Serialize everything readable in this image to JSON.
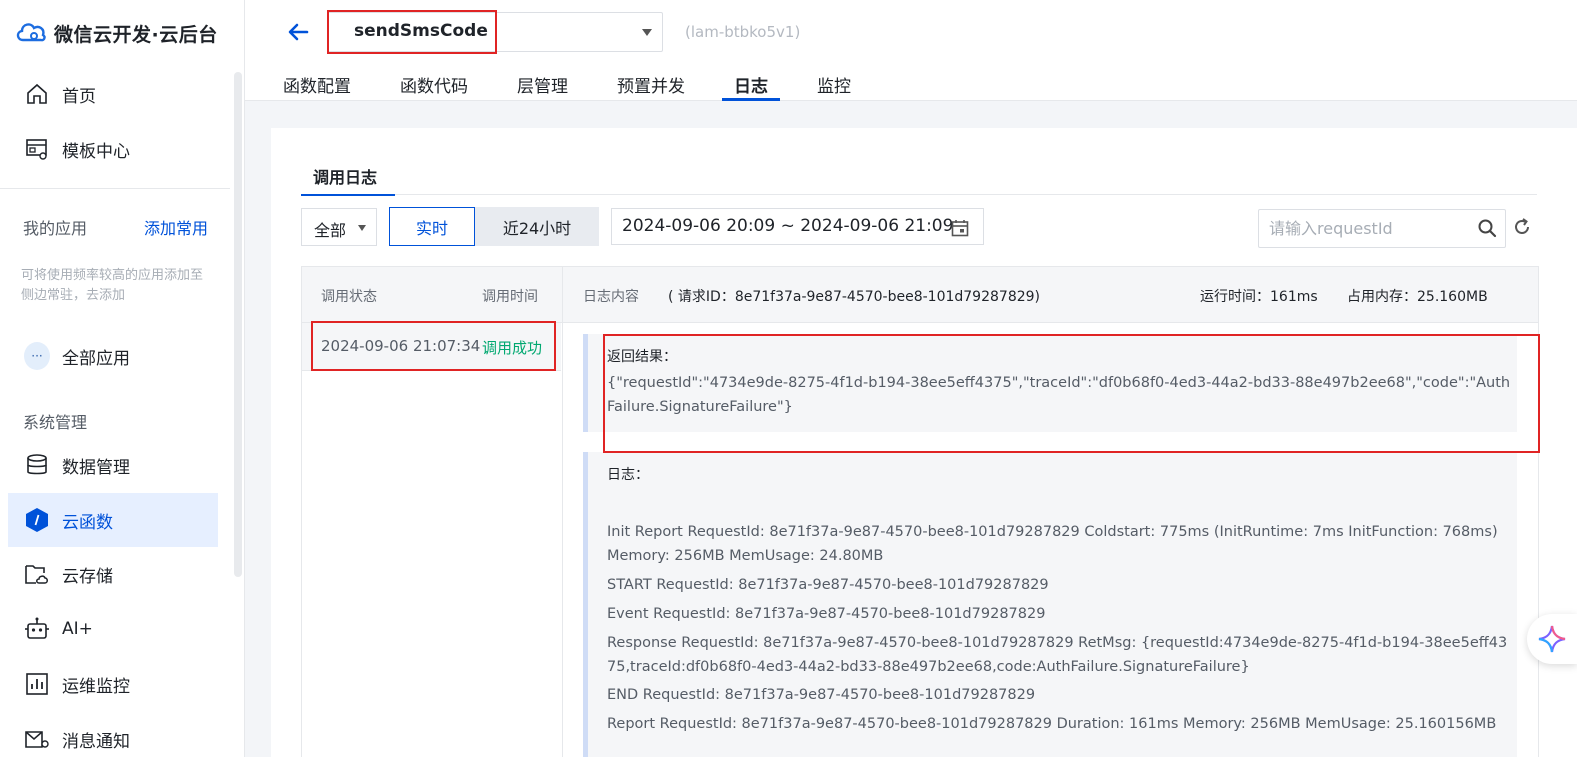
{
  "brand": {
    "title": "微信云开发·云后台"
  },
  "sidebar": {
    "top_items": [
      {
        "label": "首页",
        "icon": "home-icon"
      },
      {
        "label": "模板中心",
        "icon": "template-icon"
      }
    ],
    "my_apps_label": "我的应用",
    "add_common_label": "添加常用",
    "hint": "可将使用频率较高的应用添加至侧边常驻，去添加",
    "all_apps_label": "全部应用",
    "system_label": "系统管理",
    "system_items": [
      {
        "label": "数据管理",
        "icon": "database-icon"
      },
      {
        "label": "云函数",
        "icon": "cloud-function-icon",
        "active": true
      },
      {
        "label": "云存储",
        "icon": "cloud-storage-icon"
      },
      {
        "label": "AI+",
        "icon": "robot-icon"
      },
      {
        "label": "运维监控",
        "icon": "monitor-chart-icon"
      },
      {
        "label": "消息通知",
        "icon": "message-icon"
      }
    ]
  },
  "header": {
    "function_name": "sendSmsCode",
    "env_id": "(lam-btbko5v1)",
    "tabs": [
      "函数配置",
      "函数代码",
      "层管理",
      "预置并发",
      "日志",
      "监控"
    ],
    "active_tab": "日志"
  },
  "panel": {
    "sub_tab": "调用日志",
    "filter_all": "全部",
    "seg_realtime": "实时",
    "seg_24h": "近24小时",
    "date_range": "2024-09-06 20:09 ~ 2024-09-06 21:09",
    "search_placeholder": "请输入requestId"
  },
  "table": {
    "col_status": "调用状态",
    "col_time": "调用时间",
    "col_content": "日志内容",
    "request_id_label": "( 请求ID：8e71f37a-9e87-4570-bee8-101d79287829)",
    "run_time": "运行时间：161ms",
    "memory": "占用内存：25.160MB",
    "row": {
      "time": "2024-09-06 21:07:34",
      "status": "调用成功"
    }
  },
  "result": {
    "label": "返回结果：",
    "body": "{\"requestId\":\"4734e9de-8275-4f1d-b194-38ee5eff4375\",\"traceId\":\"df0b68f0-4ed3-44a2-bd33-88e497b2ee68\",\"code\":\"AuthFailure.SignatureFailure\"}"
  },
  "logs": {
    "label": "日志：",
    "lines": [
      " Init Report RequestId: 8e71f37a-9e87-4570-bee8-101d79287829 Coldstart: 775ms (InitRuntime: 7ms InitFunction: 768ms) Memory: 256MB MemUsage: 24.80MB",
      "START RequestId: 8e71f37a-9e87-4570-bee8-101d79287829",
      "Event RequestId: 8e71f37a-9e87-4570-bee8-101d79287829",
      "Response RequestId: 8e71f37a-9e87-4570-bee8-101d79287829 RetMsg: {requestId:4734e9de-8275-4f1d-b194-38ee5eff4375,traceId:df0b68f0-4ed3-44a2-bd33-88e497b2ee68,code:AuthFailure.SignatureFailure}",
      "END RequestId: 8e71f37a-9e87-4570-bee8-101d79287829",
      "Report RequestId: 8e71f37a-9e87-4570-bee8-101d79287829 Duration: 161ms Memory: 256MB MemUsage: 25.160156MB"
    ]
  },
  "colors": {
    "accent": "#0052d9",
    "success": "#00a870",
    "highlight": "#e02424"
  }
}
